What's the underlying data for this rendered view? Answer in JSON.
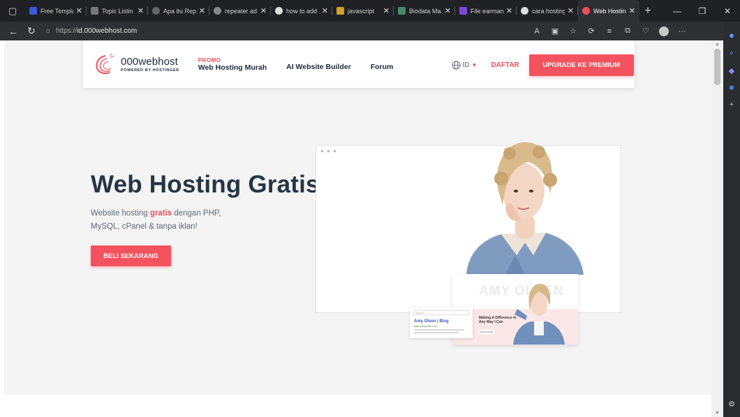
{
  "browser": {
    "tabs": [
      {
        "title": "Free Templa",
        "color": "#3a5ad9",
        "active": false
      },
      {
        "title": "Topic Listin",
        "color": "#777777",
        "active": false
      },
      {
        "title": "Apa itu Rep",
        "color": "#666666",
        "active": false
      },
      {
        "title": "repeater ad",
        "color": "#888888",
        "active": false
      },
      {
        "title": "how to add",
        "color": "#dddddd",
        "active": false
      },
      {
        "title": "javascript",
        "color": "#d4a02a",
        "active": false
      },
      {
        "title": "Biodata Ma",
        "color": "#4a8a6a",
        "active": false
      },
      {
        "title": "File earman",
        "color": "#7a4ad9",
        "active": false
      },
      {
        "title": "cara hosting",
        "color": "#dddddd",
        "active": false
      },
      {
        "title": "Web Hostin",
        "color": "#ef4f5b",
        "active": true
      }
    ],
    "url_prefix": "https://",
    "url_host": "id.000webhost.com",
    "new_tab": "+"
  },
  "header": {
    "logo_name": "000webhost",
    "logo_sub": "POWERED BY HOSTINGER",
    "promo_tag": "PROMO",
    "promo_link": "Web Hosting Murah",
    "ai_link": "AI Website Builder",
    "forum_link": "Forum",
    "lang": "ID",
    "register": "DAFTAR",
    "upgrade": "UPGRADE KE PREMIUM"
  },
  "hero": {
    "title": "Web Hosting Gratis",
    "desc_before": "Website hosting ",
    "desc_highlight": "gratis",
    "desc_after": " dengan PHP, MySQL, cPanel & tanpa iklan!",
    "cta": "BELI SEKARANG"
  },
  "preview": {
    "mini_big": "AMY OLSEN",
    "mini_text": "Making A Difference In Any Way I Can",
    "mini_btn": "READ MORE",
    "blog_search": "Search",
    "blog_title": "Amy Olsen | Blog",
    "blog_url": "https://amyolsen.com"
  },
  "colors": {
    "brand": "#ef4f5b",
    "heading": "#253545"
  }
}
